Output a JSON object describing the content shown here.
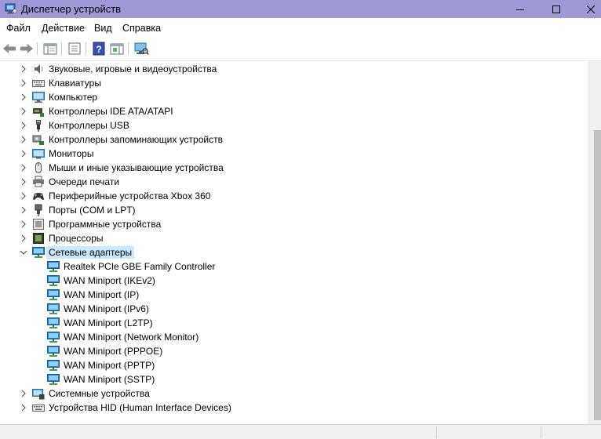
{
  "window": {
    "title": "Диспетчер устройств"
  },
  "menu": [
    {
      "label": "Файл"
    },
    {
      "label": "Действие"
    },
    {
      "label": "Вид"
    },
    {
      "label": "Справка"
    }
  ],
  "toolbar": {
    "buttons": [
      {
        "icon": "back-arrow-icon"
      },
      {
        "icon": "forward-arrow-icon"
      },
      {
        "icon": "show-hide-console-tree-icon"
      },
      {
        "icon": "properties-icon"
      },
      {
        "icon": "help-icon"
      },
      {
        "icon": "action-pane-icon"
      },
      {
        "icon": "scan-hardware-icon"
      }
    ]
  },
  "tree": {
    "items": [
      {
        "label": "Звуковые, игровые и видеоустройства",
        "icon": "speaker-icon",
        "expanded": false
      },
      {
        "label": "Клавиатуры",
        "icon": "keyboard-icon",
        "expanded": false
      },
      {
        "label": "Компьютер",
        "icon": "computer-icon",
        "expanded": false
      },
      {
        "label": "Контроллеры IDE ATA/ATAPI",
        "icon": "ide-controller-icon",
        "expanded": false
      },
      {
        "label": "Контроллеры USB",
        "icon": "usb-icon",
        "expanded": false
      },
      {
        "label": "Контроллеры запоминающих устройств",
        "icon": "storage-controller-icon",
        "expanded": false
      },
      {
        "label": "Мониторы",
        "icon": "monitor-icon",
        "expanded": false
      },
      {
        "label": "Мыши и иные указывающие устройства",
        "icon": "mouse-icon",
        "expanded": false
      },
      {
        "label": "Очереди печати",
        "icon": "printer-icon",
        "expanded": false
      },
      {
        "label": "Периферийные устройства Xbox 360",
        "icon": "gamepad-icon",
        "expanded": false
      },
      {
        "label": "Порты (COM и LPT)",
        "icon": "port-icon",
        "expanded": false
      },
      {
        "label": "Программные устройства",
        "icon": "software-device-icon",
        "expanded": false
      },
      {
        "label": "Процессоры",
        "icon": "processor-icon",
        "expanded": false
      },
      {
        "label": "Сетевые адаптеры",
        "icon": "network-adapter-icon",
        "expanded": true,
        "selected": true,
        "children": [
          {
            "label": "Realtek PCIe GBE Family Controller"
          },
          {
            "label": "WAN Miniport (IKEv2)"
          },
          {
            "label": "WAN Miniport (IP)"
          },
          {
            "label": "WAN Miniport (IPv6)"
          },
          {
            "label": "WAN Miniport (L2TP)"
          },
          {
            "label": "WAN Miniport (Network Monitor)"
          },
          {
            "label": "WAN Miniport (PPPOE)"
          },
          {
            "label": "WAN Miniport (PPTP)"
          },
          {
            "label": "WAN Miniport (SSTP)"
          }
        ]
      },
      {
        "label": "Системные устройства",
        "icon": "system-device-icon",
        "expanded": false
      },
      {
        "label": "Устройства HID (Human Interface Devices)",
        "icon": "hid-icon",
        "expanded": false
      }
    ]
  },
  "colors": {
    "titlebar": "#9e98d6",
    "selection": "#cce8ff",
    "network_icon": "#2a7fc9"
  }
}
